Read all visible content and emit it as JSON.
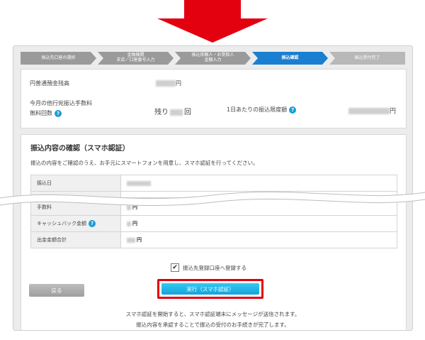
{
  "colors": {
    "arrow": "#e3000f",
    "active_step": "#1a7fd0",
    "exec_button": "#1aaae4",
    "highlight": "#e3000f"
  },
  "steps": [
    {
      "label": "振込先口座の選択"
    },
    {
      "label": "金融機関\n支店／口座番号入力"
    },
    {
      "label": "振込依頼人・お受取人\n金額入力"
    },
    {
      "label": "振込確認"
    },
    {
      "label": "振込受付完了"
    }
  ],
  "balance": {
    "label": "円普通預金残高",
    "value_suffix": "円",
    "fee_label_1": "今月の他行宛振込手数料",
    "fee_label_2": "無料回数",
    "remaining_prefix": "残り",
    "remaining_suffix": "回",
    "limit_label": "1日あたりの振込限度額",
    "limit_suffix": "円"
  },
  "confirm": {
    "title": "振込内容の確認（スマホ認証）",
    "description": "振込の内容をご確認のうえ、お手元にスマートフォンを用意し、スマホ認証を行ってください。",
    "rows": [
      {
        "label": "振込日",
        "suffix": ""
      },
      {
        "label": "手数料",
        "suffix": "円"
      },
      {
        "label": "キャッシュバック金額",
        "suffix": "円"
      },
      {
        "label": "出金金額合計",
        "suffix": "円"
      }
    ]
  },
  "register_checkbox": {
    "label": "振込先登録口座へ登録する",
    "checked": true
  },
  "buttons": {
    "back": "戻る",
    "execute": "実行（スマホ認証）"
  },
  "notes": {
    "line1": "スマホ認証を開始すると、スマホ認証端末にメッセージが送信されます。",
    "line2": "振込内容を承認することで振込の受付のお手続きが完了します。"
  }
}
